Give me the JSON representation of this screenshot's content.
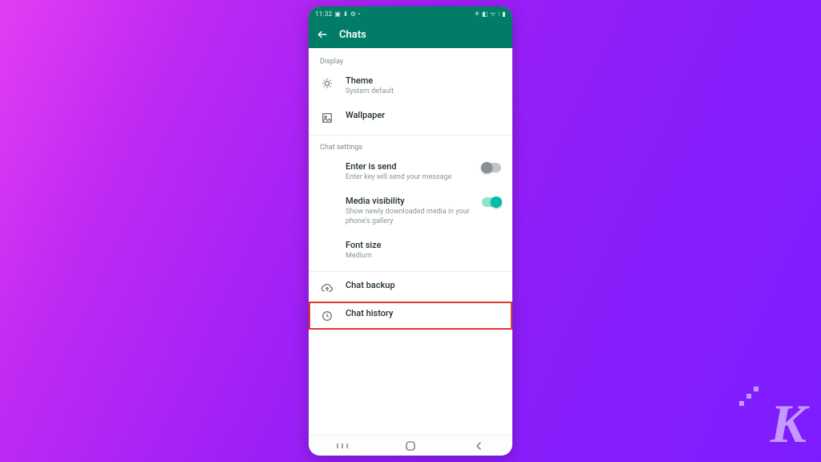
{
  "status": {
    "time": "11:32",
    "left_icons": "▣ ⬇ ⚙ •",
    "right_icons": "⚘ ◧ ᯤ ⁝ ▮"
  },
  "appbar": {
    "title": "Chats"
  },
  "sections": {
    "display": {
      "header": "Display",
      "theme": {
        "title": "Theme",
        "sub": "System default"
      },
      "wallpaper": {
        "title": "Wallpaper"
      }
    },
    "chat": {
      "header": "Chat settings",
      "enter": {
        "title": "Enter is send",
        "sub": "Enter key will send your message",
        "on": false
      },
      "media": {
        "title": "Media visibility",
        "sub": "Show newly downloaded media in your phone's gallery",
        "on": true
      },
      "font": {
        "title": "Font size",
        "sub": "Medium"
      },
      "backup": {
        "title": "Chat backup"
      },
      "history": {
        "title": "Chat history"
      }
    }
  },
  "watermark": "K"
}
